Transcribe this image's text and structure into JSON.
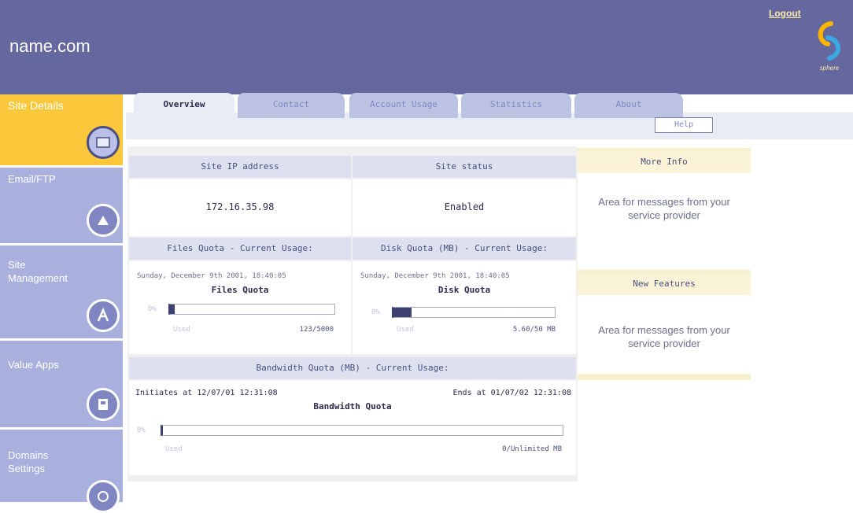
{
  "header": {
    "site_name": "name.com",
    "logout_label": "Logout",
    "brand_text": "sphere",
    "brand_icon": "swirl-logo-icon",
    "colors": {
      "header_bg": "#64689e",
      "accent": "#fac83a",
      "sidebar": "#a9b0de"
    }
  },
  "sidebar": {
    "items": [
      {
        "label": "Site Details",
        "icon": "site-details-icon",
        "active": true
      },
      {
        "label": "Email/FTP",
        "icon": "email-ftp-icon",
        "active": false
      },
      {
        "label": "Site Management",
        "icon": "site-management-icon",
        "active": false
      },
      {
        "label": "Value Apps",
        "icon": "value-apps-icon",
        "active": false
      },
      {
        "label": "Domains Settings",
        "icon": "domains-settings-icon",
        "active": false
      }
    ]
  },
  "tabs": [
    {
      "label": "Overview",
      "active": true
    },
    {
      "label": "Contact",
      "active": false
    },
    {
      "label": "Account Usage",
      "active": false
    },
    {
      "label": "Statistics",
      "active": false
    },
    {
      "label": "About",
      "active": false
    }
  ],
  "help_label": "Help",
  "main": {
    "ip_header": "Site IP address",
    "ip_value": "172.16.35.98",
    "status_header": "Site status",
    "status_value": "Enabled",
    "files_quota": {
      "header": "Files Quota - Current Usage:",
      "timestamp": "Sunday, December 9th 2001, 18:40:05",
      "title": "Files Quota",
      "start_label": "0%",
      "used_label": "Used",
      "usage": "123/5000",
      "fill_fraction": 0.025
    },
    "disk_quota": {
      "header": "Disk Quota (MB) - Current Usage:",
      "timestamp": "Sunday, December 9th 2001, 18:40:05",
      "title": "Disk Quota",
      "start_label": "0%",
      "used_label": "Used",
      "usage": "5.60/50 MB",
      "fill_fraction": 0.11
    },
    "bandwidth_quota": {
      "header": "Bandwidth Quota (MB) - Current Usage:",
      "initiates": "Initiates at 12/07/01 12:31:08",
      "ends": "Ends at 01/07/02 12:31:08",
      "title": "Bandwidth Quota",
      "start_label": "0%",
      "used_label": "Used",
      "usage": "0/Unlimited MB",
      "fill_fraction": 0.0
    }
  },
  "info_panels": [
    {
      "title": "More Info",
      "body": "Area for messages from your service provider"
    },
    {
      "title": "New Features",
      "body": "Area for messages from your service provider"
    }
  ]
}
